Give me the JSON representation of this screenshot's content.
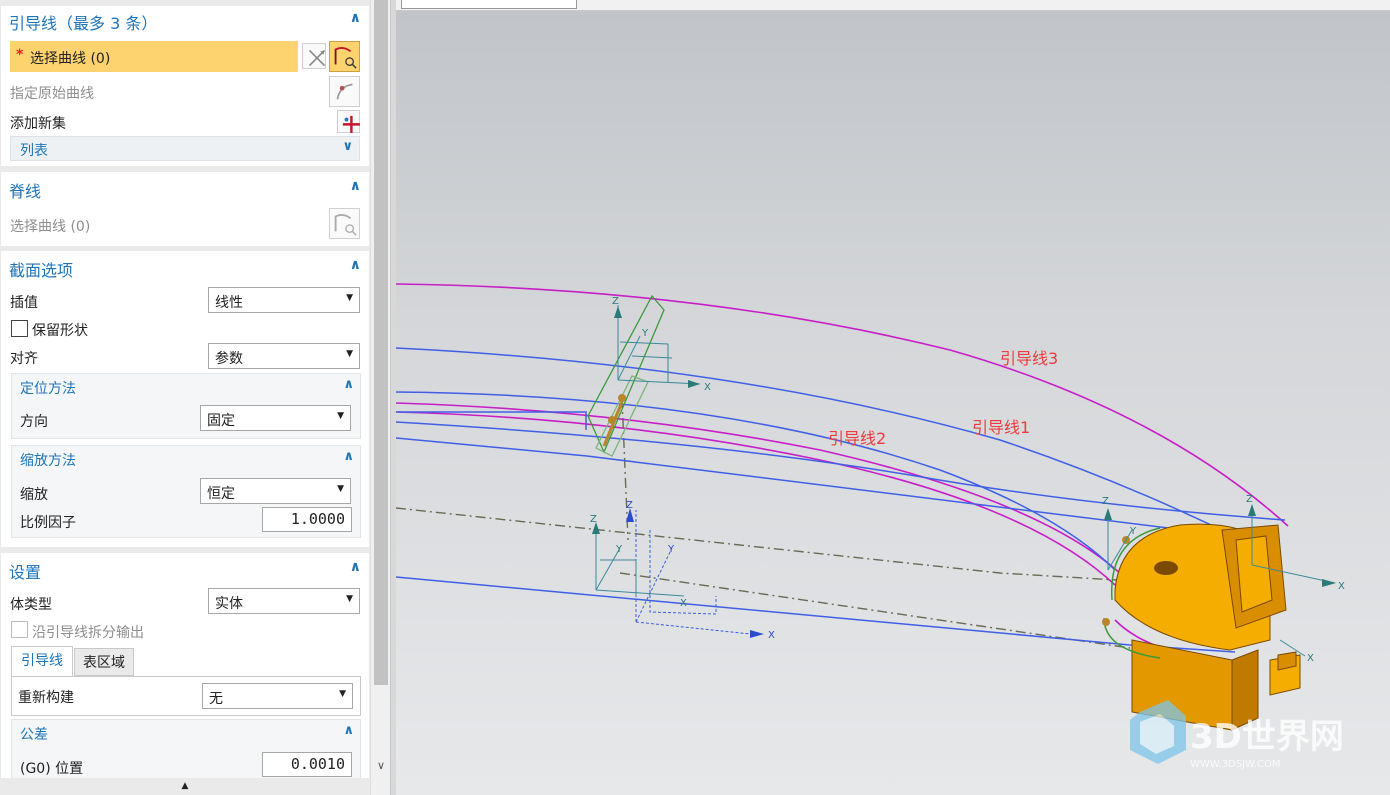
{
  "guide_group": {
    "title": "引导线（最多 3 条）",
    "select_curve_star": "*",
    "select_curve_label": "选择曲线 (0)",
    "specify_original_curve": "指定原始曲线",
    "add_new_set": "添加新集",
    "list_label": "列表"
  },
  "spine_group": {
    "title": "脊线",
    "select_curve_label": "选择曲线 (0)"
  },
  "section_options": {
    "title": "截面选项",
    "interpolation_label": "插值",
    "interpolation_value": "线性",
    "preserve_shape_label": "保留形状",
    "preserve_shape_checked": false,
    "align_label": "对齐",
    "align_value": "参数",
    "orientation": {
      "title": "定位方法",
      "direction_label": "方向",
      "direction_value": "固定"
    },
    "scaling": {
      "title": "缩放方法",
      "scale_label": "缩放",
      "scale_value": "恒定",
      "factor_label": "比例因子",
      "factor_value": "1.0000"
    }
  },
  "settings": {
    "title": "设置",
    "body_type_label": "体类型",
    "body_type_value": "实体",
    "split_output_label": "沿引导线拆分输出",
    "tabs": [
      "引导线",
      "表区域"
    ],
    "active_tab": "引导线",
    "rebuild_label": "重新构建",
    "rebuild_value": "无",
    "tolerance": {
      "title": "公差",
      "g0_label": "(G0) 位置",
      "g0_value": "0.0010"
    }
  },
  "viewport": {
    "labels": {
      "guide1": "引导线1",
      "guide2": "引导线2",
      "guide3": "引导线3"
    },
    "axis_labels": {
      "x": "X",
      "y": "Y",
      "z": "Z"
    },
    "watermark": {
      "brand": "3D世界网",
      "url": "WWW.3DSJW.COM"
    }
  },
  "colors": {
    "accent": "#1f74b8",
    "selection_highlight": "#fcd36f",
    "guide_blue": "#3f5fe6",
    "guide_magenta": "#c81ec8",
    "part_orange": "#f4ad00",
    "annotation_red": "#ee3b3b"
  },
  "icons": [
    "cross-select-icon",
    "curve-select-icon",
    "original-curve-icon",
    "add-set-icon",
    "chevron-down-icon",
    "collapse-up-icon"
  ]
}
